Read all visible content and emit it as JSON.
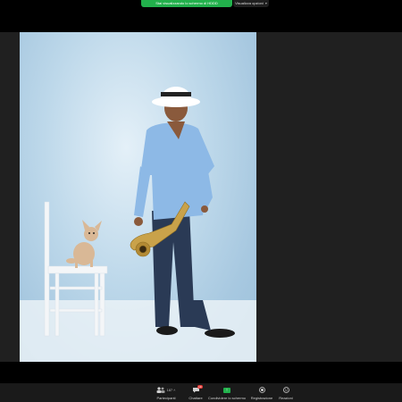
{
  "topbar": {
    "share_status": "Stai visualizzando lo schermo di HDDD",
    "view_options": "Visualizza opzioni"
  },
  "toolbar": {
    "participants": {
      "label": "Partecipanti",
      "count": "187"
    },
    "chat": {
      "label": "Chattare",
      "badge": "19"
    },
    "share": {
      "label": "Condividere lo schermo"
    },
    "record": {
      "label": "Registrazione"
    },
    "reactions": {
      "label": "Reazioni"
    }
  },
  "colors": {
    "share_green": "#22b14c",
    "badge_red": "#e53935",
    "stage_gray": "#202020"
  },
  "icons": [
    "participants-icon",
    "chat-icon",
    "share-screen-icon",
    "record-icon",
    "reactions-icon",
    "chevron-down-icon"
  ]
}
